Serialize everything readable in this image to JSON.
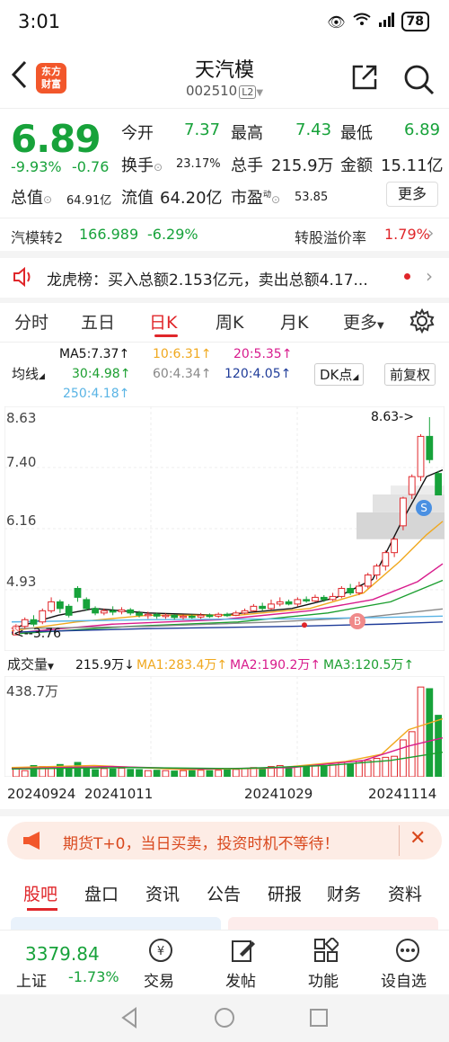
{
  "status": {
    "time": "3:01",
    "battery": "78"
  },
  "header": {
    "logo_line1": "东方",
    "logo_line2": "财富",
    "name": "天汽模",
    "code": "002510",
    "level": "L2"
  },
  "quote": {
    "price": "6.89",
    "change_pct": "-9.93%",
    "change": "-0.76",
    "open_label": "今开",
    "open": "7.37",
    "high_label": "最高",
    "high": "7.43",
    "low_label": "最低",
    "low": "6.89",
    "turnover_label": "换手",
    "turnover": "23.17%",
    "volume_label": "总手",
    "volume": "215.9万",
    "amount_label": "金额",
    "amount": "15.11亿",
    "mktcap_label": "总值",
    "mktcap": "64.91亿",
    "float_label": "流值",
    "float": "64.20亿",
    "pe_label": "市盈",
    "pe_sup": "动",
    "pe": "53.85",
    "more": "更多"
  },
  "convertible": {
    "name": "汽模转2",
    "price": "166.989",
    "pct": "-6.29%",
    "premium_label": "转股溢价率",
    "premium": "1.79%"
  },
  "lhb": {
    "text": "龙虎榜：买入总额2.153亿元，卖出总额4.17..."
  },
  "tabs": [
    "分时",
    "五日",
    "日K",
    "周K",
    "月K",
    "更多"
  ],
  "ma": {
    "chip": "均线",
    "ma5": "MA5:7.37↑",
    "ma10": "10:6.31↑",
    "ma20": "20:5.35↑",
    "ma30": "30:4.98↑",
    "ma60": "60:4.34↑",
    "ma120": "120:4.05↑",
    "ma250": "250:4.18↑",
    "dk": "DK点",
    "fq": "前复权",
    "colors": {
      "ma5": "#111111",
      "ma10": "#f0a81e",
      "ma20": "#d81b8c",
      "ma30": "#1b9e2f",
      "ma60": "#888888",
      "ma120": "#1f3c99",
      "ma250": "#5ab4e5"
    }
  },
  "kline": {
    "y_top": "8.63",
    "y2": "7.40",
    "y3": "6.16",
    "y4": "4.93",
    "high_mark": "8.63->",
    "low_mark": "<--3.76",
    "badge_s": "S",
    "badge_b": "B"
  },
  "volume": {
    "chip": "成交量",
    "val": "215.9万↓",
    "ma1": "MA1:283.4万↑",
    "ma2": "MA2:190.2万↑",
    "ma3": "MA3:120.5万↑",
    "max": "438.7万"
  },
  "dates": [
    "20240924",
    "20241011",
    "20241029",
    "20241114"
  ],
  "banner": {
    "text": "期货T+0，当日买卖，投资时机不等待！"
  },
  "subtabs": [
    "股吧",
    "盘口",
    "资讯",
    "公告",
    "研报",
    "财务",
    "资料"
  ],
  "bottom": {
    "index_value": "3379.84",
    "index_name": "上证",
    "index_pct": "-1.73%",
    "trade": "交易",
    "post": "发帖",
    "function": "功能",
    "watchlist": "设自选"
  }
}
